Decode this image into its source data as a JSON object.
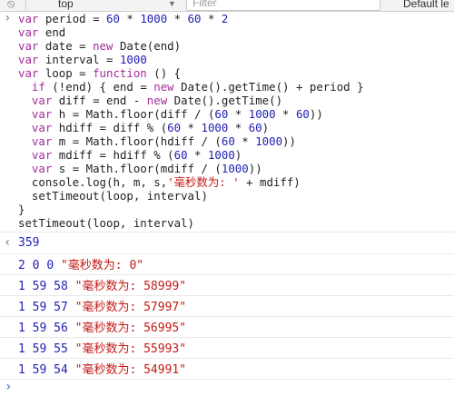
{
  "toolbar": {
    "context_label": "top",
    "filter_placeholder": "Filter",
    "levels_label": "Default le"
  },
  "console": {
    "input_lines": [
      "var period = 60 * 1000 * 60 * 2",
      "var end",
      "var date = new Date(end)",
      "var interval = 1000",
      "var loop = function () {",
      "  if (!end) { end = new Date().getTime() + period }",
      "  var diff = end - new Date().getTime()",
      "  var h = Math.floor(diff / (60 * 1000 * 60))",
      "  var hdiff = diff % (60 * 1000 * 60)",
      "  var m = Math.floor(hdiff / (60 * 1000))",
      "  var mdiff = hdiff % (60 * 1000)",
      "  var s = Math.floor(mdiff / (1000))",
      "  console.log(h, m, s,'毫秒数为: ' + mdiff)",
      "  setTimeout(loop, interval)",
      "}",
      "setTimeout(loop, interval)"
    ],
    "return_value": "359",
    "logs": [
      {
        "h": "2",
        "m": "0",
        "s": "0",
        "msg": "\"毫秒数为: 0\""
      },
      {
        "h": "1",
        "m": "59",
        "s": "58",
        "msg": "\"毫秒数为: 58999\""
      },
      {
        "h": "1",
        "m": "59",
        "s": "57",
        "msg": "\"毫秒数为: 57997\""
      },
      {
        "h": "1",
        "m": "59",
        "s": "56",
        "msg": "\"毫秒数为: 56995\""
      },
      {
        "h": "1",
        "m": "59",
        "s": "55",
        "msg": "\"毫秒数为: 55993\""
      },
      {
        "h": "1",
        "m": "59",
        "s": "54",
        "msg": "\"毫秒数为: 54991\""
      }
    ],
    "colors": {
      "keyword": "#a32d9a",
      "number": "#1f1fb3",
      "string": "#c41a16",
      "prompt": "#2a6fdb"
    }
  }
}
